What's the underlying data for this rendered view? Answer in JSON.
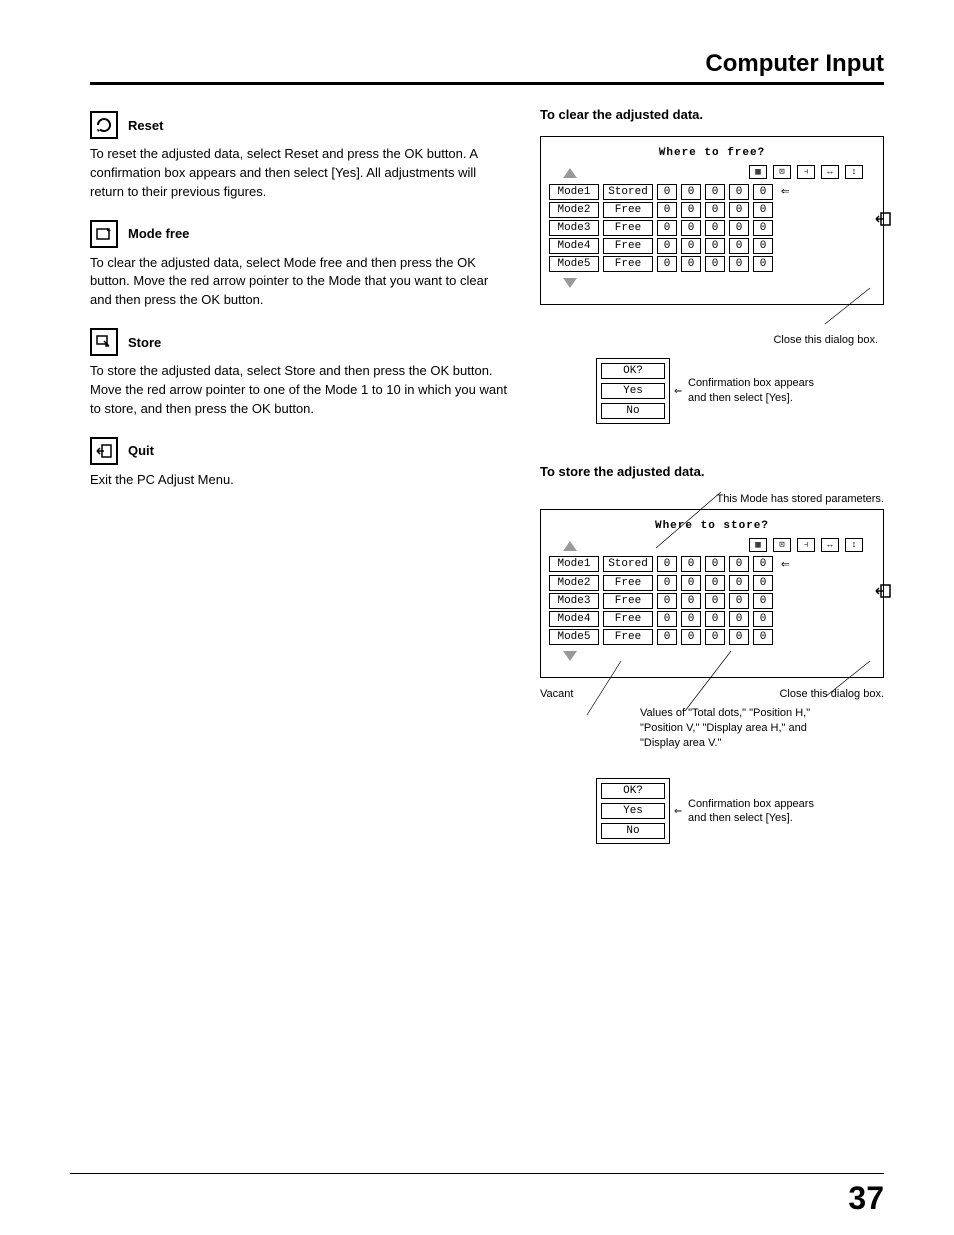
{
  "header": {
    "title": "Computer Input"
  },
  "sections": {
    "reset": {
      "title": "Reset",
      "body": "To reset the adjusted data, select Reset and press the OK button. A confirmation box appears and then select [Yes]. All adjustments will return to their previous figures."
    },
    "modefree": {
      "title": "Mode free",
      "body": "To clear the adjusted data, select Mode free and then press the OK button. Move the red arrow pointer to the Mode that you want to clear and then press the OK button."
    },
    "store": {
      "title": "Store",
      "body": "To store the adjusted data, select Store and then press the OK button. Move the red arrow pointer to one of the Mode 1 to 10 in which you want to store, and then press the OK button."
    },
    "quit": {
      "title": "Quit",
      "body": "Exit the PC Adjust Menu."
    }
  },
  "clear": {
    "heading": "To clear the adjusted data.",
    "dialog_title": "Where to free?",
    "rows": [
      {
        "name": "Mode1",
        "status": "Stored",
        "vals": [
          "0",
          "0",
          "0",
          "0",
          "0"
        ],
        "pointer": true
      },
      {
        "name": "Mode2",
        "status": "Free",
        "vals": [
          "0",
          "0",
          "0",
          "0",
          "0"
        ]
      },
      {
        "name": "Mode3",
        "status": "Free",
        "vals": [
          "0",
          "0",
          "0",
          "0",
          "0"
        ]
      },
      {
        "name": "Mode4",
        "status": "Free",
        "vals": [
          "0",
          "0",
          "0",
          "0",
          "0"
        ]
      },
      {
        "name": "Mode5",
        "status": "Free",
        "vals": [
          "0",
          "0",
          "0",
          "0",
          "0"
        ]
      }
    ],
    "close_caption": "Close this dialog box.",
    "confirm": {
      "title": "OK?",
      "yes": "Yes",
      "no": "No"
    },
    "confirm_caption": "Confirmation box appears and then select [Yes]."
  },
  "store_panel": {
    "heading": "To store the adjusted data.",
    "note": "This Mode has stored parameters.",
    "dialog_title": "Where to store?",
    "rows": [
      {
        "name": "Mode1",
        "status": "Stored",
        "vals": [
          "0",
          "0",
          "0",
          "0",
          "0"
        ],
        "pointer": true
      },
      {
        "name": "Mode2",
        "status": "Free",
        "vals": [
          "0",
          "0",
          "0",
          "0",
          "0"
        ]
      },
      {
        "name": "Mode3",
        "status": "Free",
        "vals": [
          "0",
          "0",
          "0",
          "0",
          "0"
        ]
      },
      {
        "name": "Mode4",
        "status": "Free",
        "vals": [
          "0",
          "0",
          "0",
          "0",
          "0"
        ]
      },
      {
        "name": "Mode5",
        "status": "Free",
        "vals": [
          "0",
          "0",
          "0",
          "0",
          "0"
        ]
      }
    ],
    "vacant": "Vacant",
    "values_caption": "Values of \"Total dots,\" \"Position H,\" \"Position V,\" \"Display area H,\" and \"Display area V.\"",
    "close_caption": "Close this dialog box.",
    "confirm": {
      "title": "OK?",
      "yes": "Yes",
      "no": "No"
    },
    "confirm_caption": "Confirmation box appears and then select [Yes]."
  },
  "page_number": "37"
}
